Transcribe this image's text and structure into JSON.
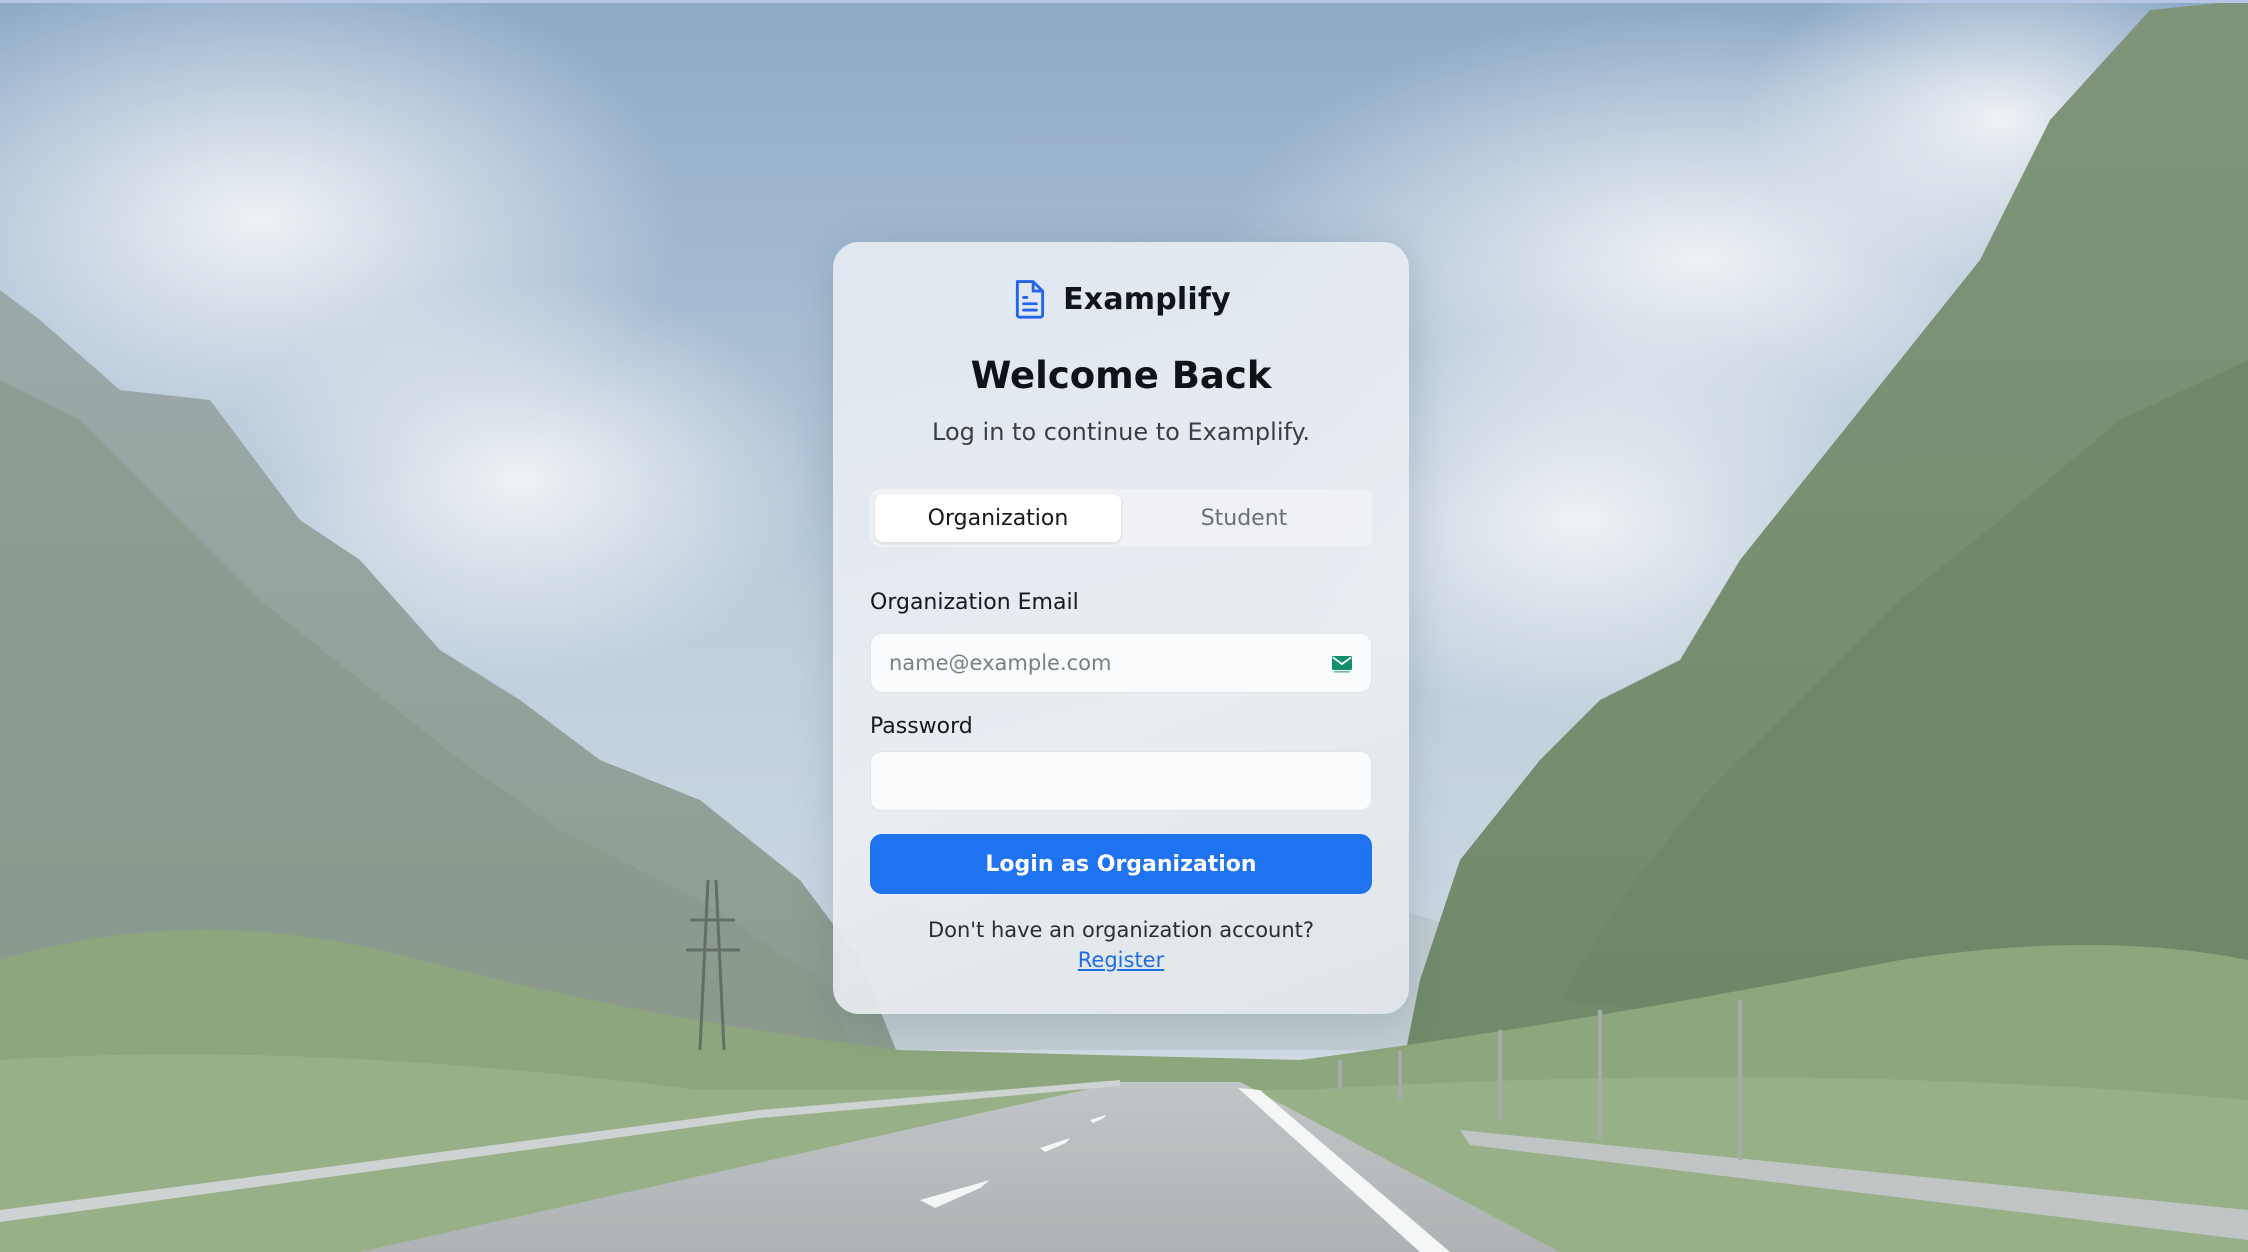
{
  "brand": {
    "name": "Examplify",
    "icon": "document-icon",
    "accent_color": "#1f73f0"
  },
  "heading": {
    "title": "Welcome Back",
    "subtitle": "Log in to continue to Examplify."
  },
  "tabs": [
    {
      "label": "Organization",
      "active": true
    },
    {
      "label": "Student",
      "active": false
    }
  ],
  "form": {
    "email_label": "Organization Email",
    "email_placeholder": "name@example.com",
    "email_value": "",
    "email_icon": "mail-icon",
    "password_label": "Password",
    "password_value": "",
    "submit_label": "Login as Organization"
  },
  "footer": {
    "prompt": "Don't have an organization account?",
    "register_label": "Register"
  }
}
